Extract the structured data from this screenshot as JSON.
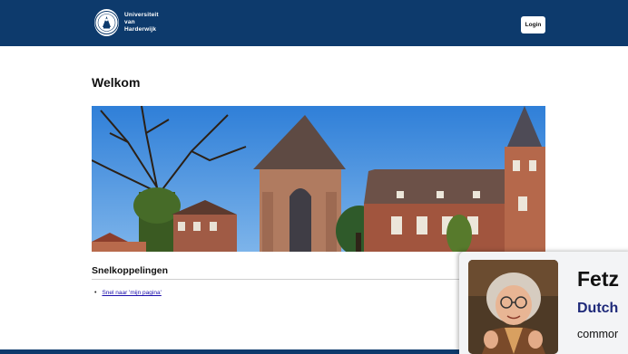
{
  "header": {
    "logo_line1": "Universiteit",
    "logo_line2": "van",
    "logo_line3": "Harderwijk",
    "login_label": "Login"
  },
  "main": {
    "heading": "Welkom",
    "quick_links_title": "Snelkoppelingen",
    "quick_links": [
      "Snel naar 'mijn pagina'"
    ]
  },
  "overlay": {
    "title": "Fetz",
    "subtitle": "Dutch",
    "caption": "commor"
  },
  "colors": {
    "brand": "#0d3a6c",
    "link": "#1a0dab",
    "overlay_subtitle": "#1f2a7a"
  }
}
